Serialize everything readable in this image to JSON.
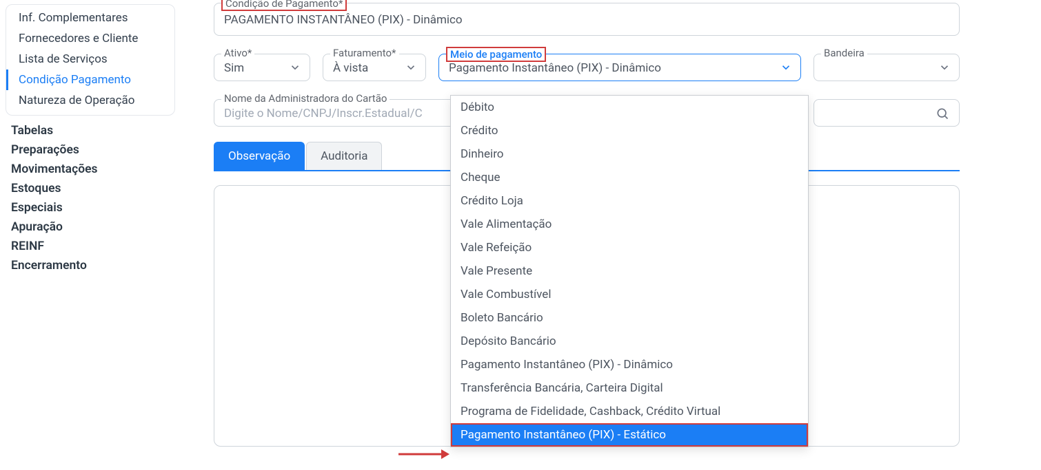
{
  "sidebar": {
    "group_items": [
      {
        "label": "Inf. Complementares",
        "active": false
      },
      {
        "label": "Fornecedores e Cliente",
        "active": false
      },
      {
        "label": "Lista de Serviços",
        "active": false
      },
      {
        "label": "Condição Pagamento",
        "active": true
      },
      {
        "label": "Natureza de Operação",
        "active": false
      }
    ],
    "headings": [
      "Tabelas",
      "Preparações",
      "Movimentações",
      "Estoques",
      "Especiais",
      "Apuração",
      "REINF",
      "Encerramento"
    ]
  },
  "form": {
    "condicao": {
      "label": "Condição de Pagamento*",
      "value": "PAGAMENTO INSTANTÂNEO (PIX) - Dinâmico"
    },
    "ativo": {
      "label": "Ativo*",
      "value": "Sim"
    },
    "faturamento": {
      "label": "Faturamento*",
      "value": "À vista"
    },
    "meio": {
      "label": "Meio de pagamento",
      "value": "Pagamento Instantâneo (PIX) - Dinâmico"
    },
    "bandeira": {
      "label": "Bandeira",
      "value": ""
    },
    "admin_cartao": {
      "label": "Nome da Administradora do Cartão",
      "placeholder": "Digite o Nome/CNPJ/Inscr.Estadual/C"
    }
  },
  "tabs": {
    "observacao": "Observação",
    "auditoria": "Auditoria"
  },
  "dropdown": {
    "options": [
      "Débito",
      "Crédito",
      "Dinheiro",
      "Cheque",
      "Crédito Loja",
      "Vale Alimentação",
      "Vale Refeição",
      "Vale Presente",
      "Vale Combustível",
      "Boleto Bancário",
      "Depósito Bancário",
      "Pagamento Instantâneo (PIX) - Dinâmico",
      "Transferência Bancária, Carteira Digital",
      "Programa de Fidelidade, Cashback, Crédito Virtual",
      "Pagamento Instantâneo (PIX) - Estático"
    ],
    "highlighted_index": 14
  }
}
